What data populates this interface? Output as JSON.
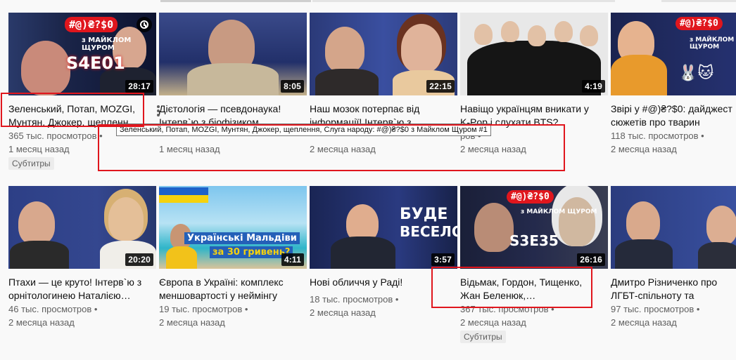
{
  "colors": {
    "background": "#f9f9f9",
    "highlight_red": "#e0161d",
    "title_text": "#0f0f0f",
    "meta_text": "#606060"
  },
  "tooltip": "Зеленський, Потап, MOZGI, Мунтян, Джокер, щеплення, Слуга народу: #@)₴?$0 з Майклом Щуром #1",
  "row1": [
    {
      "title": "Зеленський, Потап, MOZGI, Мунтян, Джокер, щепленн…",
      "duration": "28:17",
      "views": "365 тыс. просмотров",
      "age": "1 месяц назад",
      "badge": "Субтитры",
      "thumb_overlay": {
        "logo": "#@)₴?$0",
        "subtitle": "з МАЙКЛОМ ЩУРОМ",
        "episode": "S4E01"
      },
      "icons": [
        "watch-later-clock-icon",
        "more-vert-icon"
      ]
    },
    {
      "title": "Дієтологія — псевдонаука! Інтерв`ю з біофізиком…",
      "duration": "8:05",
      "views": "",
      "age": "1 месяц назад"
    },
    {
      "title": "Наш мозок потерпає від інформації! Інтерв`ю з…",
      "duration": "22:15",
      "views": "",
      "age": "2 месяца назад"
    },
    {
      "title": "Навіщо українцям вникати у K-Pop і слухати BTS?",
      "duration": "4:19",
      "views": "ров •",
      "age": "2 месяца назад"
    },
    {
      "title": "Звірі у #@)₴?$0: дайджест сюжетів про тварин",
      "duration": "",
      "views": "118 тыс. просмотров",
      "age": "2 месяца назад",
      "thumb_overlay": {
        "logo": "#@)₴?$0",
        "subtitle": "з МАЙКЛОМ ЩУРОМ"
      }
    }
  ],
  "row2": [
    {
      "title": "Птахи — це круто! Інтерв`ю з орнітологинею Наталією…",
      "duration": "20:20",
      "views": "46 тыс. просмотров",
      "age": "2 месяца назад"
    },
    {
      "title": "Європа в Україні: комплекс меншовартості у неймінгу",
      "duration": "4:11",
      "views": "19 тыс. просмотров",
      "age": "2 месяца назад",
      "thumb_overlay": {
        "text1": "Українські Мальдіви",
        "text2": "за 30 гривень?"
      }
    },
    {
      "title": "Нові обличчя у Раді!",
      "duration": "3:57",
      "views": "18 тыс. просмотров",
      "age": "2 месяца назад",
      "thumb_overlay": {
        "text1": "БУДЕ",
        "text2": "ВЕСЕЛО!"
      }
    },
    {
      "title": "Відьмак, Гордон, Тищенко, Жан Беленюк,…",
      "duration": "26:16",
      "views": "367 тыс. просмотров",
      "age": "2 месяца назад",
      "badge": "Субтитры",
      "thumb_overlay": {
        "logo": "#@)₴?$0",
        "subtitle": "з МАЙКЛОМ ЩУРОМ",
        "episode": "S3E35"
      }
    },
    {
      "title": "Дмитро Різниченко про ЛГБТ-спільноту та правий…",
      "duration": "",
      "views": "97 тыс. просмотров",
      "age": "2 месяца назад"
    }
  ]
}
